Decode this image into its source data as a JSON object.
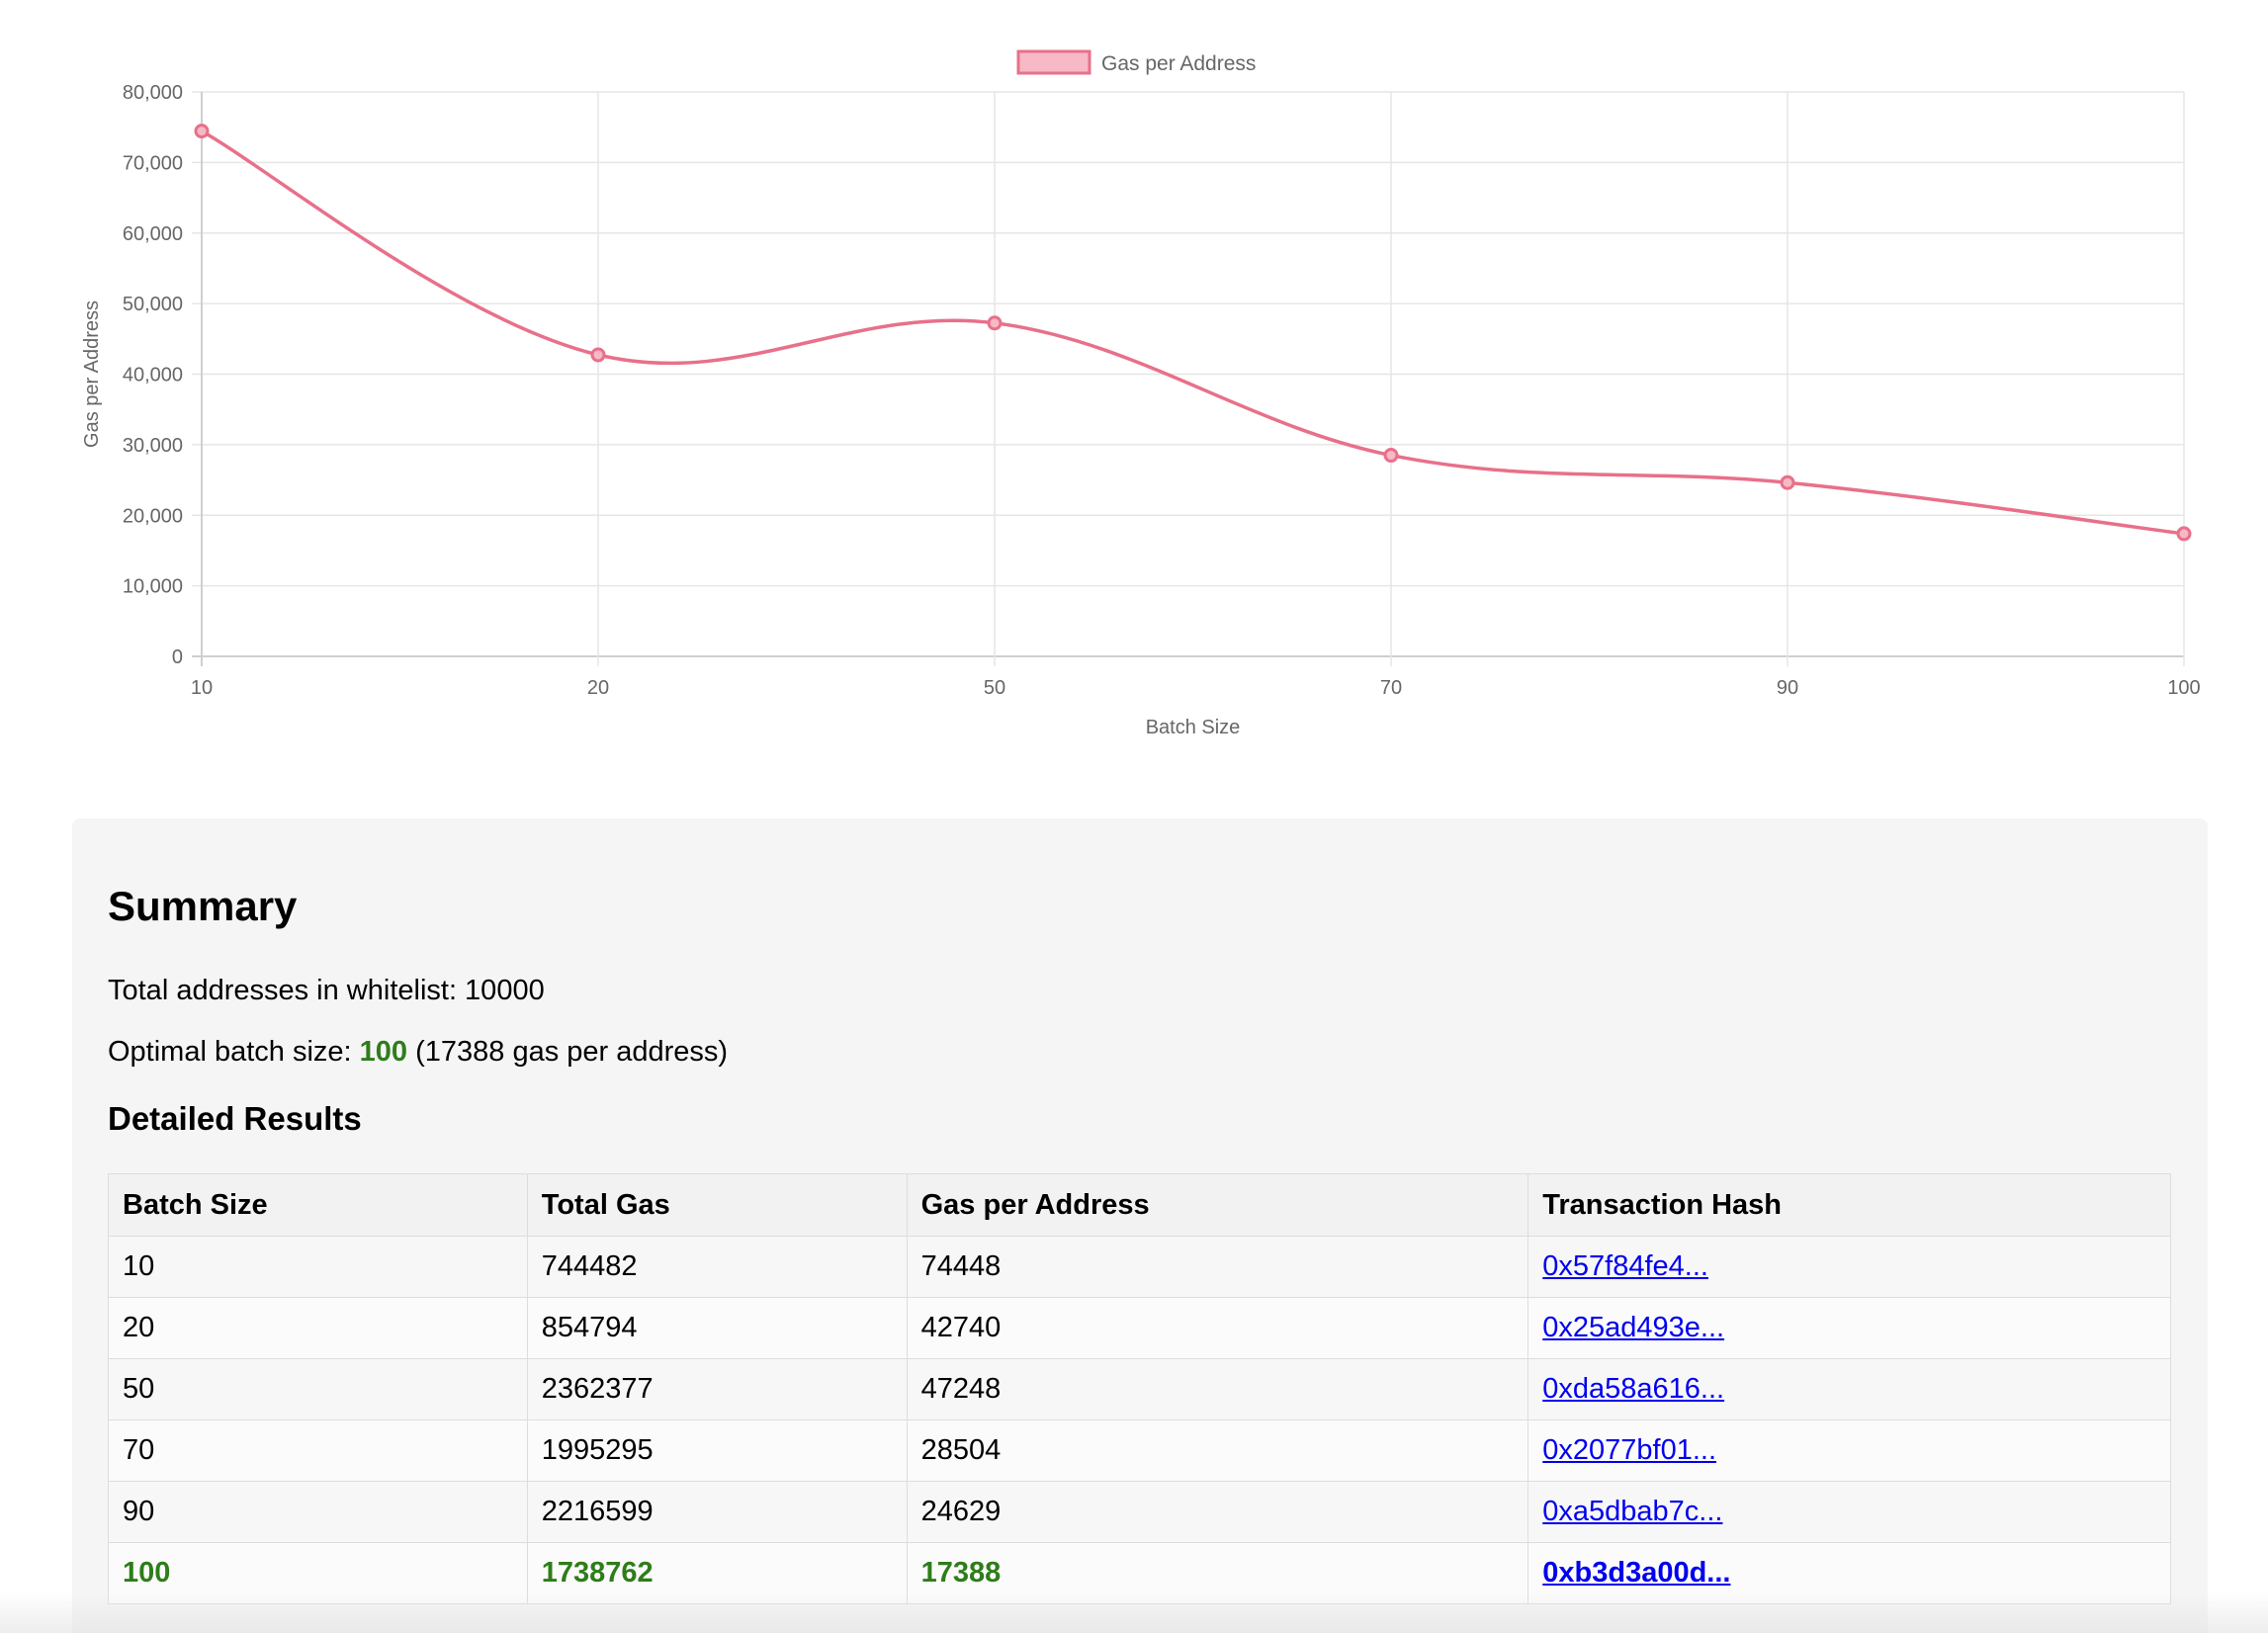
{
  "chart_data": {
    "type": "line",
    "x": [
      "10",
      "20",
      "50",
      "70",
      "90",
      "100"
    ],
    "series": [
      {
        "name": "Gas per Address",
        "values": [
          74448,
          42740,
          47248,
          28504,
          24629,
          17388
        ],
        "color": "#e8708a",
        "fill": "#f7b9c6"
      }
    ],
    "xlabel": "Batch Size",
    "ylabel": "Gas per Address",
    "ylim": [
      0,
      80000
    ],
    "yticks": [
      "0",
      "10,000",
      "20,000",
      "30,000",
      "40,000",
      "50,000",
      "60,000",
      "70,000",
      "80,000"
    ],
    "grid": true,
    "legend": "top-center"
  },
  "summary": {
    "title": "Summary",
    "total_label": "Total addresses in whitelist: 10000",
    "optimal_prefix": "Optimal batch size: ",
    "optimal_value": "100",
    "optimal_suffix": " (17388 gas per address)"
  },
  "details": {
    "title": "Detailed Results",
    "columns": [
      "Batch Size",
      "Total Gas",
      "Gas per Address",
      "Transaction Hash"
    ],
    "rows": [
      {
        "batch": "10",
        "total": "744482",
        "per": "74448",
        "hash": "0x57f84fe4..."
      },
      {
        "batch": "20",
        "total": "854794",
        "per": "42740",
        "hash": "0x25ad493e..."
      },
      {
        "batch": "50",
        "total": "2362377",
        "per": "47248",
        "hash": "0xda58a616..."
      },
      {
        "batch": "70",
        "total": "1995295",
        "per": "28504",
        "hash": "0x2077bf01..."
      },
      {
        "batch": "90",
        "total": "2216599",
        "per": "24629",
        "hash": "0xa5dbab7c..."
      },
      {
        "batch": "100",
        "total": "1738762",
        "per": "17388",
        "hash": "0xb3d3a00d..."
      }
    ]
  },
  "colors": {
    "accent_green": "#2e7d1a",
    "link_blue": "#0000ee",
    "panel_bg": "#f5f5f5"
  }
}
